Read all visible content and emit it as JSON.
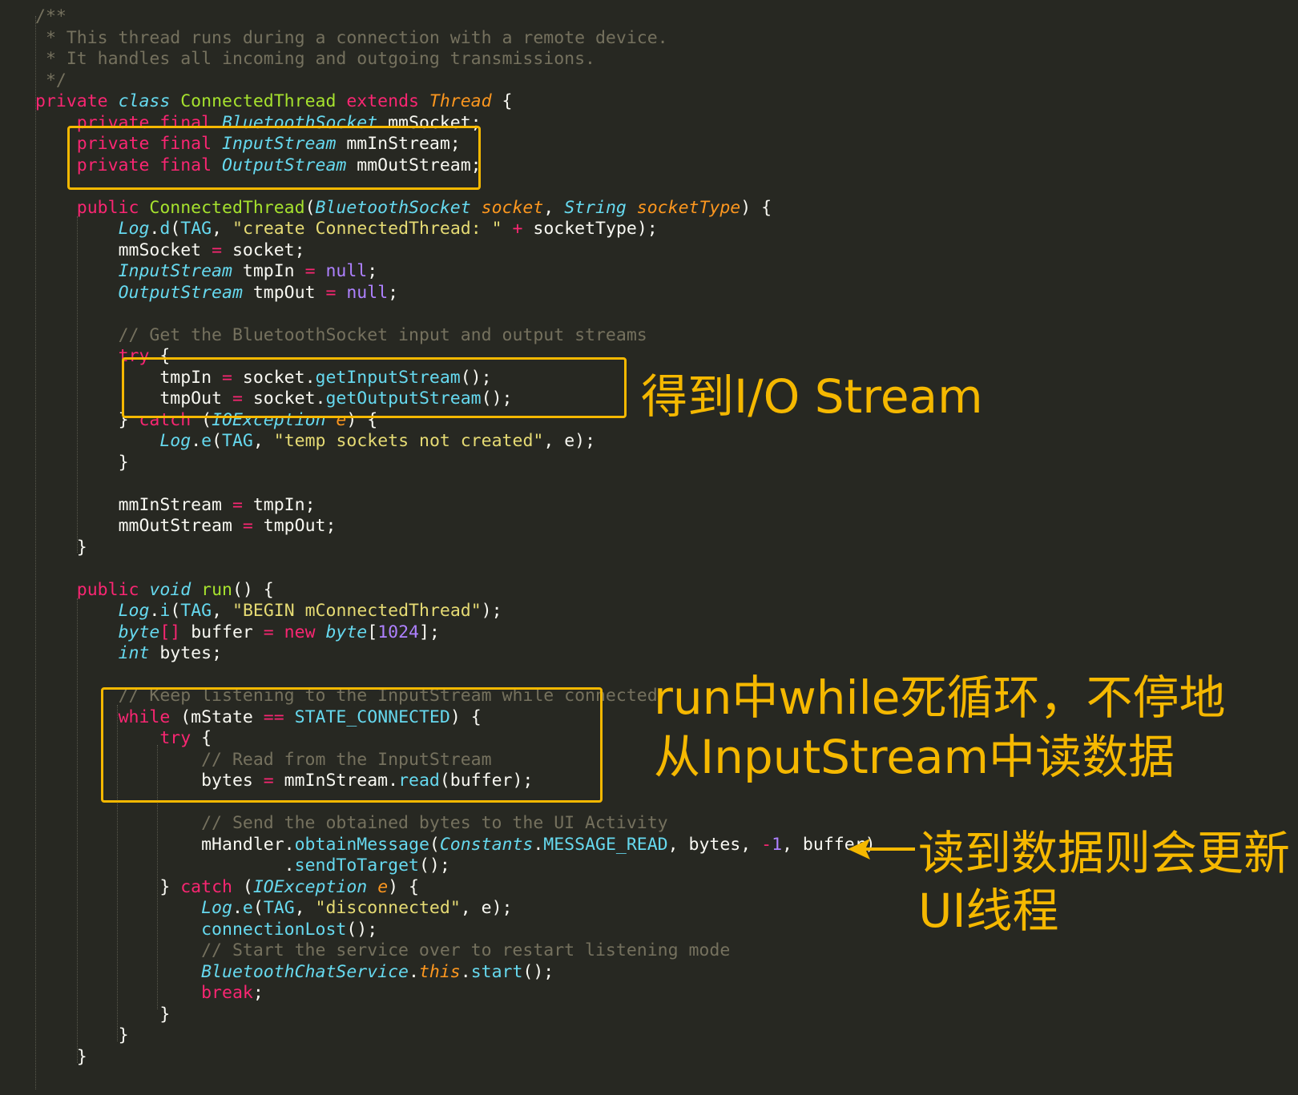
{
  "code_lines": [
    {
      "indent": 0,
      "tokens": [
        {
          "c": "c",
          "t": "/**"
        }
      ]
    },
    {
      "indent": 0,
      "tokens": [
        {
          "c": "c",
          "t": " * This thread runs during a connection with a remote device."
        }
      ]
    },
    {
      "indent": 0,
      "tokens": [
        {
          "c": "c",
          "t": " * It handles all incoming and outgoing transmissions."
        }
      ]
    },
    {
      "indent": 0,
      "tokens": [
        {
          "c": "c",
          "t": " */"
        }
      ]
    },
    {
      "indent": 0,
      "tokens": [
        {
          "c": "k",
          "t": "private "
        },
        {
          "c": "s",
          "t": "class "
        },
        {
          "c": "f",
          "t": "ConnectedThread "
        },
        {
          "c": "k",
          "t": "extends "
        },
        {
          "c": "p",
          "t": "Thread"
        },
        {
          "c": "t",
          "t": " {"
        }
      ]
    },
    {
      "indent": 4,
      "tokens": [
        {
          "c": "k",
          "t": "private final "
        },
        {
          "c": "s",
          "t": "BluetoothSocket"
        },
        {
          "c": "t",
          "t": " mmSocket;"
        }
      ]
    },
    {
      "indent": 4,
      "tokens": [
        {
          "c": "k",
          "t": "private final "
        },
        {
          "c": "s",
          "t": "InputStream"
        },
        {
          "c": "t",
          "t": " mmInStream;"
        }
      ]
    },
    {
      "indent": 4,
      "tokens": [
        {
          "c": "k",
          "t": "private final "
        },
        {
          "c": "s",
          "t": "OutputStream"
        },
        {
          "c": "t",
          "t": " mmOutStream;"
        }
      ]
    },
    {
      "indent": 0,
      "tokens": []
    },
    {
      "indent": 4,
      "tokens": [
        {
          "c": "k",
          "t": "public "
        },
        {
          "c": "f",
          "t": "ConnectedThread"
        },
        {
          "c": "t",
          "t": "("
        },
        {
          "c": "s",
          "t": "BluetoothSocket "
        },
        {
          "c": "p",
          "t": "socket"
        },
        {
          "c": "t",
          "t": ", "
        },
        {
          "c": "s",
          "t": "String "
        },
        {
          "c": "p",
          "t": "socketType"
        },
        {
          "c": "t",
          "t": ") {"
        }
      ]
    },
    {
      "indent": 8,
      "tokens": [
        {
          "c": "s",
          "t": "Log"
        },
        {
          "c": "t",
          "t": "."
        },
        {
          "c": "b",
          "t": "d"
        },
        {
          "c": "t",
          "t": "("
        },
        {
          "c": "b",
          "t": "TAG"
        },
        {
          "c": "t",
          "t": ", "
        },
        {
          "c": "str",
          "t": "\"create ConnectedThread: \""
        },
        {
          "c": "k",
          "t": " + "
        },
        {
          "c": "t",
          "t": "socketType);"
        }
      ]
    },
    {
      "indent": 8,
      "tokens": [
        {
          "c": "t",
          "t": "mmSocket "
        },
        {
          "c": "k",
          "t": "= "
        },
        {
          "c": "t",
          "t": "socket;"
        }
      ]
    },
    {
      "indent": 8,
      "tokens": [
        {
          "c": "s",
          "t": "InputStream"
        },
        {
          "c": "t",
          "t": " tmpIn "
        },
        {
          "c": "k",
          "t": "= "
        },
        {
          "c": "n",
          "t": "null"
        },
        {
          "c": "t",
          "t": ";"
        }
      ]
    },
    {
      "indent": 8,
      "tokens": [
        {
          "c": "s",
          "t": "OutputStream"
        },
        {
          "c": "t",
          "t": " tmpOut "
        },
        {
          "c": "k",
          "t": "= "
        },
        {
          "c": "n",
          "t": "null"
        },
        {
          "c": "t",
          "t": ";"
        }
      ]
    },
    {
      "indent": 0,
      "tokens": []
    },
    {
      "indent": 8,
      "tokens": [
        {
          "c": "c",
          "t": "// Get the BluetoothSocket input and output streams"
        }
      ]
    },
    {
      "indent": 8,
      "tokens": [
        {
          "c": "k",
          "t": "try "
        },
        {
          "c": "t",
          "t": "{"
        }
      ]
    },
    {
      "indent": 12,
      "tokens": [
        {
          "c": "t",
          "t": "tmpIn "
        },
        {
          "c": "k",
          "t": "= "
        },
        {
          "c": "t",
          "t": "socket."
        },
        {
          "c": "b",
          "t": "getInputStream"
        },
        {
          "c": "t",
          "t": "();"
        }
      ]
    },
    {
      "indent": 12,
      "tokens": [
        {
          "c": "t",
          "t": "tmpOut "
        },
        {
          "c": "k",
          "t": "= "
        },
        {
          "c": "t",
          "t": "socket."
        },
        {
          "c": "b",
          "t": "getOutputStream"
        },
        {
          "c": "t",
          "t": "();"
        }
      ]
    },
    {
      "indent": 8,
      "tokens": [
        {
          "c": "t",
          "t": "} "
        },
        {
          "c": "k",
          "t": "catch "
        },
        {
          "c": "t",
          "t": "("
        },
        {
          "c": "s",
          "t": "IOException "
        },
        {
          "c": "p",
          "t": "e"
        },
        {
          "c": "t",
          "t": ") {"
        }
      ]
    },
    {
      "indent": 12,
      "tokens": [
        {
          "c": "s",
          "t": "Log"
        },
        {
          "c": "t",
          "t": "."
        },
        {
          "c": "b",
          "t": "e"
        },
        {
          "c": "t",
          "t": "("
        },
        {
          "c": "b",
          "t": "TAG"
        },
        {
          "c": "t",
          "t": ", "
        },
        {
          "c": "str",
          "t": "\"temp sockets not created\""
        },
        {
          "c": "t",
          "t": ", e);"
        }
      ]
    },
    {
      "indent": 8,
      "tokens": [
        {
          "c": "t",
          "t": "}"
        }
      ]
    },
    {
      "indent": 0,
      "tokens": []
    },
    {
      "indent": 8,
      "tokens": [
        {
          "c": "t",
          "t": "mmInStream "
        },
        {
          "c": "k",
          "t": "= "
        },
        {
          "c": "t",
          "t": "tmpIn;"
        }
      ]
    },
    {
      "indent": 8,
      "tokens": [
        {
          "c": "t",
          "t": "mmOutStream "
        },
        {
          "c": "k",
          "t": "= "
        },
        {
          "c": "t",
          "t": "tmpOut;"
        }
      ]
    },
    {
      "indent": 4,
      "tokens": [
        {
          "c": "t",
          "t": "}"
        }
      ]
    },
    {
      "indent": 0,
      "tokens": []
    },
    {
      "indent": 4,
      "tokens": [
        {
          "c": "k",
          "t": "public "
        },
        {
          "c": "s",
          "t": "void "
        },
        {
          "c": "f",
          "t": "run"
        },
        {
          "c": "t",
          "t": "() {"
        }
      ]
    },
    {
      "indent": 8,
      "tokens": [
        {
          "c": "s",
          "t": "Log"
        },
        {
          "c": "t",
          "t": "."
        },
        {
          "c": "b",
          "t": "i"
        },
        {
          "c": "t",
          "t": "("
        },
        {
          "c": "b",
          "t": "TAG"
        },
        {
          "c": "t",
          "t": ", "
        },
        {
          "c": "str",
          "t": "\"BEGIN mConnectedThread\""
        },
        {
          "c": "t",
          "t": ");"
        }
      ]
    },
    {
      "indent": 8,
      "tokens": [
        {
          "c": "s",
          "t": "byte"
        },
        {
          "c": "k",
          "t": "[] "
        },
        {
          "c": "t",
          "t": "buffer "
        },
        {
          "c": "k",
          "t": "= new "
        },
        {
          "c": "s",
          "t": "byte"
        },
        {
          "c": "t",
          "t": "["
        },
        {
          "c": "n",
          "t": "1024"
        },
        {
          "c": "t",
          "t": "];"
        }
      ]
    },
    {
      "indent": 8,
      "tokens": [
        {
          "c": "s",
          "t": "int "
        },
        {
          "c": "t",
          "t": "bytes;"
        }
      ]
    },
    {
      "indent": 0,
      "tokens": []
    },
    {
      "indent": 8,
      "tokens": [
        {
          "c": "c",
          "t": "// Keep listening to the InputStream while connected"
        }
      ]
    },
    {
      "indent": 8,
      "tokens": [
        {
          "c": "k",
          "t": "while "
        },
        {
          "c": "t",
          "t": "(mState "
        },
        {
          "c": "k",
          "t": "== "
        },
        {
          "c": "b",
          "t": "STATE_CONNECTED"
        },
        {
          "c": "t",
          "t": ") {"
        }
      ]
    },
    {
      "indent": 12,
      "tokens": [
        {
          "c": "k",
          "t": "try "
        },
        {
          "c": "t",
          "t": "{"
        }
      ]
    },
    {
      "indent": 16,
      "tokens": [
        {
          "c": "c",
          "t": "// Read from the InputStream"
        }
      ]
    },
    {
      "indent": 16,
      "tokens": [
        {
          "c": "t",
          "t": "bytes "
        },
        {
          "c": "k",
          "t": "= "
        },
        {
          "c": "t",
          "t": "mmInStream."
        },
        {
          "c": "b",
          "t": "read"
        },
        {
          "c": "t",
          "t": "(buffer);"
        }
      ]
    },
    {
      "indent": 0,
      "tokens": []
    },
    {
      "indent": 16,
      "tokens": [
        {
          "c": "c",
          "t": "// Send the obtained bytes to the UI Activity"
        }
      ]
    },
    {
      "indent": 16,
      "tokens": [
        {
          "c": "t",
          "t": "mHandler."
        },
        {
          "c": "b",
          "t": "obtainMessage"
        },
        {
          "c": "t",
          "t": "("
        },
        {
          "c": "s",
          "t": "Constants"
        },
        {
          "c": "t",
          "t": "."
        },
        {
          "c": "b",
          "t": "MESSAGE_READ"
        },
        {
          "c": "t",
          "t": ", bytes, "
        },
        {
          "c": "k",
          "t": "-"
        },
        {
          "c": "n",
          "t": "1"
        },
        {
          "c": "t",
          "t": ", buffer)"
        }
      ]
    },
    {
      "indent": 24,
      "tokens": [
        {
          "c": "t",
          "t": "."
        },
        {
          "c": "b",
          "t": "sendToTarget"
        },
        {
          "c": "t",
          "t": "();"
        }
      ]
    },
    {
      "indent": 12,
      "tokens": [
        {
          "c": "t",
          "t": "} "
        },
        {
          "c": "k",
          "t": "catch "
        },
        {
          "c": "t",
          "t": "("
        },
        {
          "c": "s",
          "t": "IOException "
        },
        {
          "c": "p",
          "t": "e"
        },
        {
          "c": "t",
          "t": ") {"
        }
      ]
    },
    {
      "indent": 16,
      "tokens": [
        {
          "c": "s",
          "t": "Log"
        },
        {
          "c": "t",
          "t": "."
        },
        {
          "c": "b",
          "t": "e"
        },
        {
          "c": "t",
          "t": "("
        },
        {
          "c": "b",
          "t": "TAG"
        },
        {
          "c": "t",
          "t": ", "
        },
        {
          "c": "str",
          "t": "\"disconnected\""
        },
        {
          "c": "t",
          "t": ", e);"
        }
      ]
    },
    {
      "indent": 16,
      "tokens": [
        {
          "c": "b",
          "t": "connectionLost"
        },
        {
          "c": "t",
          "t": "();"
        }
      ]
    },
    {
      "indent": 16,
      "tokens": [
        {
          "c": "c",
          "t": "// Start the service over to restart listening mode"
        }
      ]
    },
    {
      "indent": 16,
      "tokens": [
        {
          "c": "s",
          "t": "BluetoothChatService"
        },
        {
          "c": "t",
          "t": "."
        },
        {
          "c": "p",
          "t": "this"
        },
        {
          "c": "t",
          "t": "."
        },
        {
          "c": "b",
          "t": "start"
        },
        {
          "c": "t",
          "t": "();"
        }
      ]
    },
    {
      "indent": 16,
      "tokens": [
        {
          "c": "k",
          "t": "break"
        },
        {
          "c": "t",
          "t": ";"
        }
      ]
    },
    {
      "indent": 12,
      "tokens": [
        {
          "c": "t",
          "t": "}"
        }
      ]
    },
    {
      "indent": 8,
      "tokens": [
        {
          "c": "t",
          "t": "}"
        }
      ]
    },
    {
      "indent": 4,
      "tokens": [
        {
          "c": "t",
          "t": "}"
        }
      ]
    }
  ],
  "annotations": {
    "io_stream": "得到I/O Stream",
    "run_loop_line1": "run中while死循环，不停地",
    "run_loop_line2": "从InputStream中读数据",
    "update_ui_line1": "读到数据则会更新",
    "update_ui_line2": "UI线程"
  },
  "colors": {
    "background": "#272822",
    "annotation": "#f5b800",
    "comment": "#75715e",
    "keyword": "#f92672",
    "type": "#66d9ef",
    "function": "#a6e22e",
    "param": "#fd971f",
    "string": "#e6db74",
    "number": "#ae81ff"
  }
}
